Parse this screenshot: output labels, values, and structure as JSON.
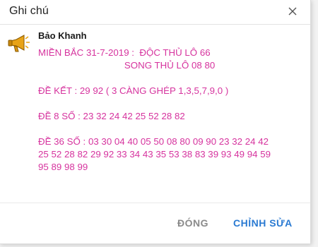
{
  "dialog": {
    "title": "Ghi chú",
    "close_icon": "close-icon"
  },
  "note": {
    "author": "Bảo Khanh",
    "icon": "megaphone-icon",
    "lines": [
      "MIỀN BẮC 31-7-2019 :  ĐỘC THỦ LÔ 66",
      "                                 SONG THỦ LÔ 08 80",
      "",
      "ĐỀ KẾT : 29 92 ( 3 CÀNG GHÉP 1,3,5,7,9,0 )",
      "",
      "ĐỀ 8 SỐ : 23 32 24 42 25 52 28 82",
      "",
      "ĐỀ 36 SỐ : 03 30 04 40 05 50 08 80 09 90 23 32 24 42",
      "25 52 28 82 29 92 33 34 43 35 53 38 83 39 93 49 94 59",
      "95 89 98 99"
    ],
    "text_color": "#d6339e"
  },
  "footer": {
    "close_label": "ĐÓNG",
    "edit_label": "CHỈNH SỬA",
    "edit_color": "#2a7ad2"
  }
}
